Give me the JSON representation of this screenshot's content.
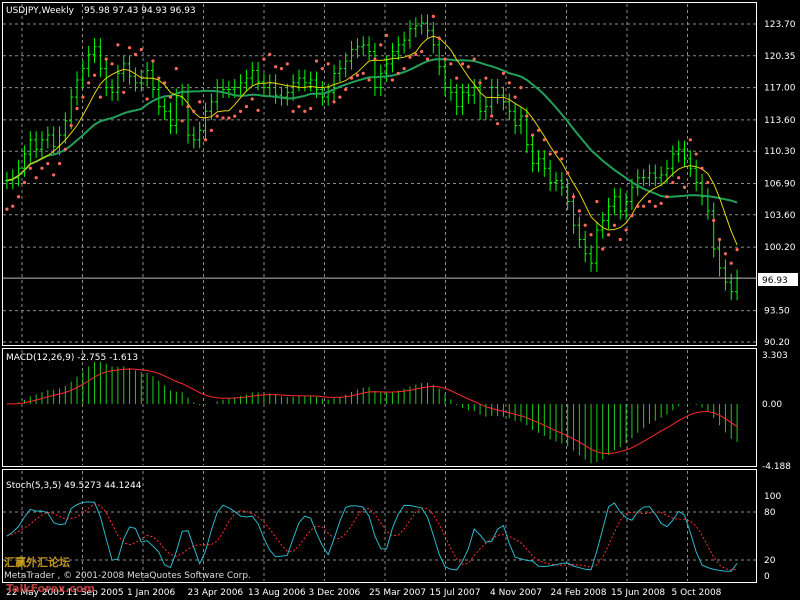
{
  "colors": {
    "background": "#000000",
    "frame": "#ffffff",
    "grid": "#8c8c8c",
    "bar": "#00ff00",
    "ma_fast": "#e5d600",
    "ma_slow": "#22a05a",
    "psar": "#ff6a5a",
    "macd_hist": "#1ecc1e",
    "macd_signal": "#ff2a2a",
    "stoch_main": "#2ab8c8",
    "stoch_signal": "#ff3030",
    "price_box_bg": "#ffffff"
  },
  "price_panel": {
    "title": "USDJPY,Weekly",
    "ohlc": "95.98 97.43 94.93 96.93",
    "current_price_label": "96.93"
  },
  "macd_panel": {
    "title": "MACD(12,26,9) -2.755 -1.613"
  },
  "stoch_panel": {
    "title": "Stoch(5,3,5) 49.5273 44.1244"
  },
  "watermark": {
    "cn": "汇赢外汇论坛",
    "url": "TalkForex.com"
  },
  "copyright": "MetaTrader , © 2001-2008 MetaQuotes Software Corp.",
  "chart_data": [
    {
      "type": "line",
      "subtype": "ohlc-bars",
      "title": "USDJPY,Weekly",
      "y_ticks": [
        "123.70",
        "120.35",
        "117.00",
        "113.60",
        "110.30",
        "106.90",
        "103.60",
        "100.20",
        "93.50",
        "90.20"
      ],
      "ylim": [
        90.2,
        123.7
      ],
      "x_ticks": [
        "22 May 2005",
        "11 Sep 2005",
        "1 Jan 2006",
        "23 Apr 2006",
        "13 Aug 2006",
        "3 Dec 2006",
        "25 Mar 2007",
        "15 Jul 2007",
        "4 Nov 2007",
        "24 Feb 2008",
        "15 Jun 2008",
        "5 Oct 2008"
      ],
      "grid": true,
      "last_bar": {
        "open": 95.98,
        "high": 97.43,
        "low": 94.93,
        "close": 96.93
      },
      "series": [
        {
          "values": [
            107.2,
            107.5,
            108.5,
            110.0,
            111.5,
            110.5,
            111.5,
            112.0,
            110.8,
            112.0,
            113.5,
            116.0,
            117.8,
            119.0,
            120.5,
            121.3,
            119.0,
            117.0,
            116.5,
            118.5,
            119.5,
            118.2,
            117.5,
            118.0,
            118.8,
            116.8,
            115.0,
            114.5,
            113.0,
            116.0,
            116.5,
            112.0,
            111.5,
            112.5,
            114.5,
            115.5,
            117.0,
            116.8,
            116.8,
            117.0,
            117.5,
            118.0,
            118.8,
            117.6,
            117.0,
            117.5,
            116.2,
            116.0,
            116.5,
            117.5,
            118.0,
            117.5,
            117.8,
            116.8,
            116.0,
            116.5,
            118.5,
            119.0,
            119.8,
            121.0,
            121.3,
            121.5,
            120.8,
            117.0,
            118.5,
            119.5,
            120.8,
            121.5,
            122.0,
            123.2,
            123.5,
            123.8,
            123.0,
            121.5,
            119.2,
            117.0,
            116.5,
            115.0,
            116.5,
            116.2,
            117.0,
            114.5,
            115.0,
            117.0,
            116.2,
            115.5,
            114.5,
            113.0,
            114.0,
            111.0,
            109.0,
            109.5,
            108.5,
            107.0,
            107.2,
            106.5,
            105.0,
            102.5,
            101.0,
            99.5,
            98.5,
            102.0,
            103.0,
            104.5,
            105.5,
            104.0,
            105.0,
            106.5,
            107.5,
            107.5,
            108.0,
            107.5,
            107.8,
            108.5,
            110.0,
            110.5,
            109.5,
            108.5,
            107.0,
            105.5,
            104.0,
            100.0,
            98.0,
            96.5,
            95.5,
            96.93
          ]
        }
      ]
    },
    {
      "type": "bar",
      "title": "MACD(12,26,9) -2.755 -1.613",
      "y_ticks": [
        "3.303",
        "0.00",
        "-4.188"
      ],
      "ylim": [
        -4.188,
        3.303
      ]
    },
    {
      "type": "line",
      "title": "Stoch(5,3,5) 49.5273 44.1244",
      "y_ticks": [
        "100",
        "80",
        "20",
        "0"
      ],
      "ylim": [
        0,
        100
      ],
      "levels": [
        80,
        20
      ]
    }
  ]
}
